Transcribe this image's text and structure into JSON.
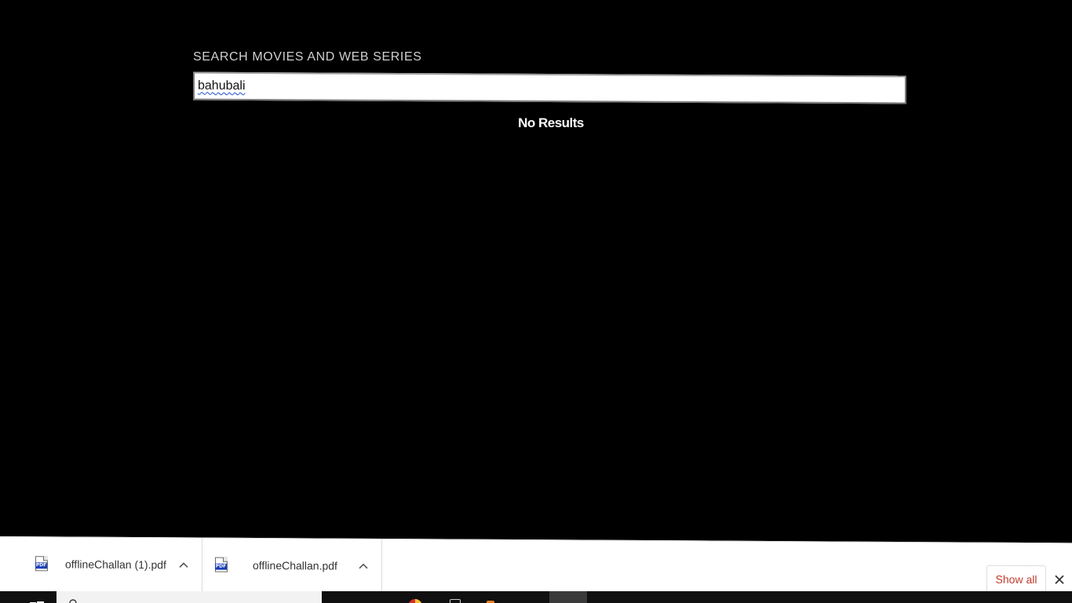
{
  "search": {
    "label": "SEARCH MOVIES AND WEB SERIES",
    "value": "bahubali"
  },
  "results": {
    "message": "No Results"
  },
  "download_shelf": {
    "items": [
      {
        "file_name": "offlineChallan (1).pdf",
        "icon": "pdf-file-icon",
        "icon_tag": "PDF"
      },
      {
        "file_name": "offlineChallan.pdf",
        "icon": "pdf-file-icon",
        "icon_tag": "PDF"
      }
    ],
    "show_all_label": "Show all",
    "close_icon": "close-icon"
  },
  "colors": {
    "background": "#000000",
    "show_all_text": "#c0392b",
    "pdf_tag": "#1b3fb6"
  }
}
